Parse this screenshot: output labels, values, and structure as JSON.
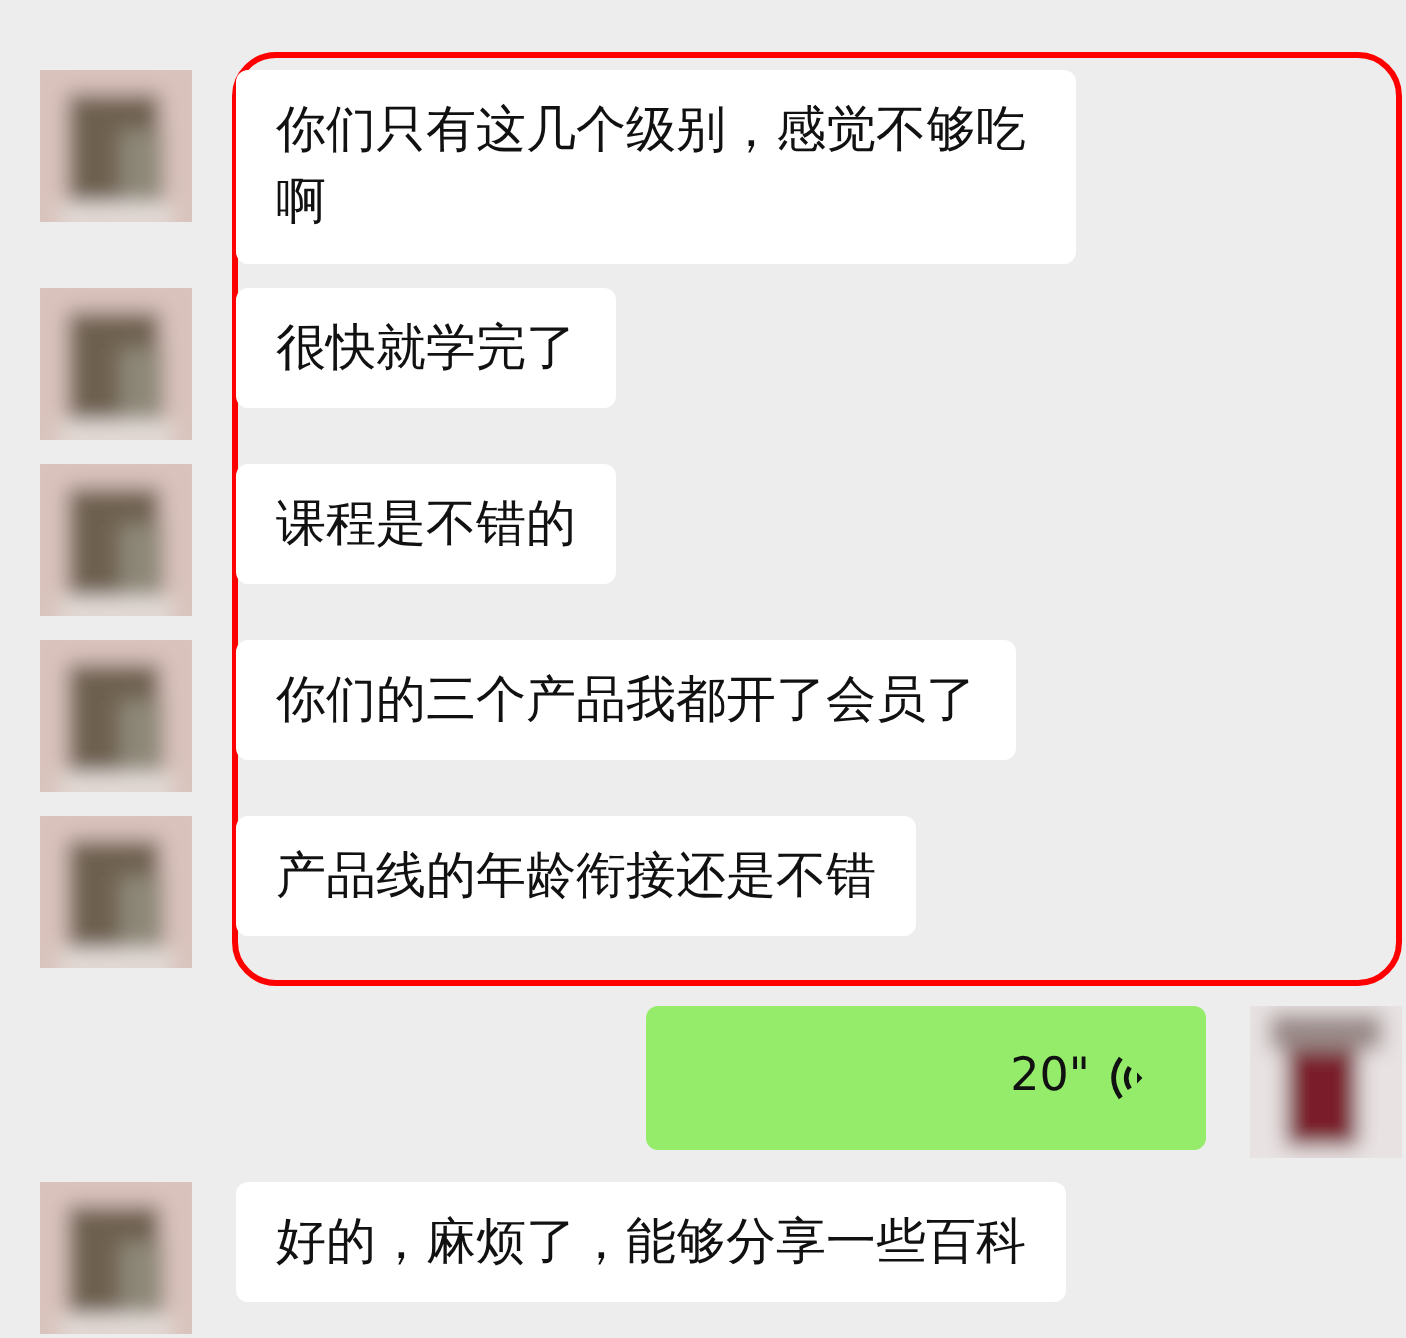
{
  "highlighted_messages": [
    {
      "kind": "text",
      "outgoing": false,
      "text": "你们只有这几个级别，感觉不够吃啊"
    },
    {
      "kind": "text",
      "outgoing": false,
      "text": "很快就学完了"
    },
    {
      "kind": "text",
      "outgoing": false,
      "text": "课程是不错的"
    },
    {
      "kind": "text",
      "outgoing": false,
      "text": "你们的三个产品我都开了会员了"
    },
    {
      "kind": "text",
      "outgoing": false,
      "text": "产品线的年龄衔接还是不错"
    }
  ],
  "messages": [
    {
      "kind": "voice",
      "outgoing": true,
      "text": "20\""
    },
    {
      "kind": "text",
      "outgoing": false,
      "text": "好的，麻烦了，能够分享一些百科"
    }
  ]
}
